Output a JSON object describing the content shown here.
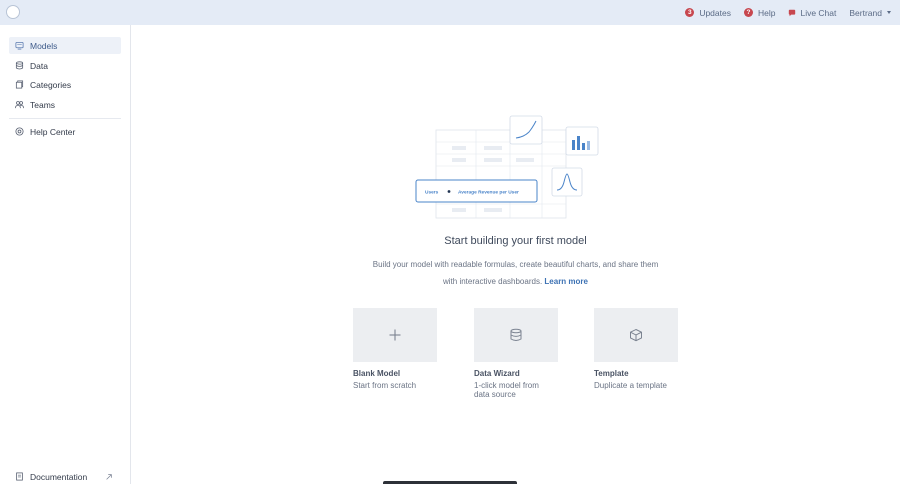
{
  "topbar": {
    "updates_count": "3",
    "updates_label": "Updates",
    "help_badge": "?",
    "help_label": "Help",
    "chat_label": "Live Chat",
    "user_label": "Bertrand"
  },
  "sidebar": {
    "items": [
      {
        "label": "Models",
        "icon": "model-icon",
        "active": true
      },
      {
        "label": "Data",
        "icon": "database-icon"
      },
      {
        "label": "Categories",
        "icon": "categories-icon"
      },
      {
        "label": "Teams",
        "icon": "teams-icon"
      }
    ],
    "help_center": "Help Center",
    "documentation": "Documentation"
  },
  "hero": {
    "users_label": "Users",
    "arpu_label": "Average Revenue per User"
  },
  "main": {
    "title": "Start building your first model",
    "description": "Build your model with readable formulas, create beautiful charts, and share them with interactive dashboards.",
    "learn_more": "Learn more"
  },
  "cards": [
    {
      "title": "Blank Model",
      "subtitle": "Start from scratch",
      "icon": "plus-icon"
    },
    {
      "title": "Data Wizard",
      "subtitle": "1-click model from data source",
      "icon": "database-icon"
    },
    {
      "title": "Template",
      "subtitle": "Duplicate a template",
      "icon": "cube-icon"
    }
  ],
  "colors": {
    "topbar_bg": "#e4ebf6",
    "accent": "#3d72b4",
    "badge": "#c7474f"
  }
}
